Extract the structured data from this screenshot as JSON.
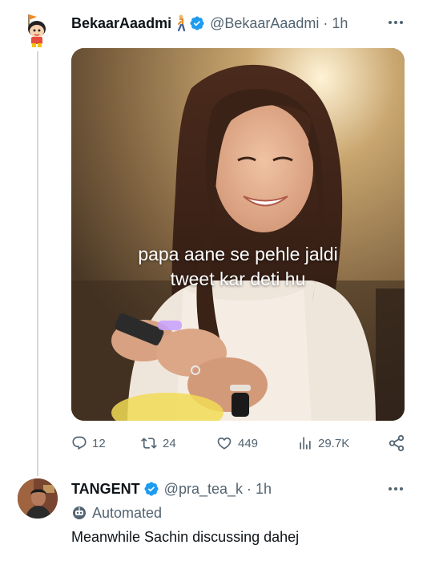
{
  "tweets": [
    {
      "display_name": "BekaarAaadmi",
      "name_emoji_icon": "person-walking-icon",
      "handle": "@BekaarAaadmi",
      "separator": "·",
      "time": "1h",
      "media": {
        "caption_line1": "papa aane se pehle jaldi",
        "caption_line2": "tweet kar deti hu"
      },
      "actions": {
        "replies": "12",
        "retweets": "24",
        "likes": "449",
        "views": "29.7K"
      }
    },
    {
      "display_name": "TANGENT",
      "handle": "@pra_tea_k",
      "separator": "·",
      "time": "1h",
      "label": "Automated",
      "text": "Meanwhile Sachin discussing dahej"
    }
  ],
  "colors": {
    "verified": "#1d9bf0",
    "secondary_text": "#536471",
    "primary_text": "#0f1419",
    "thread_line": "#cfd9de"
  }
}
